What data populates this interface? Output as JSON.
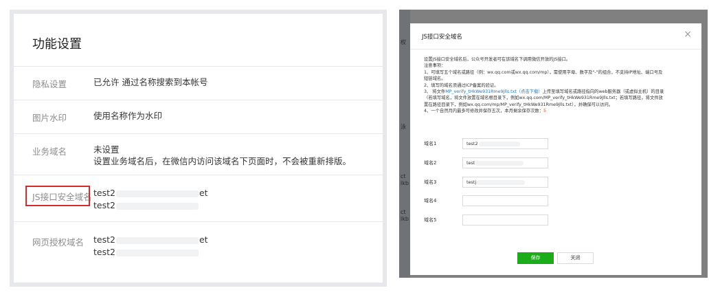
{
  "left": {
    "title": "功能设置",
    "rows": [
      {
        "label": "隐私设置",
        "lines": [
          "已允许 通过名称搜索到本帐号"
        ]
      },
      {
        "label": "图片水印",
        "lines": [
          "使用名称作为水印"
        ]
      },
      {
        "label": "业务域名",
        "lines": [
          "未设置",
          "设置业务域名后，在微信内访问该域名下页面时，不会被重新排版。"
        ]
      },
      {
        "label": "JS接口安全域名",
        "lines": [
          "test2",
          "test2"
        ],
        "tails": [
          "et",
          ""
        ]
      },
      {
        "label": "网页授权域名",
        "lines": [
          "test2",
          "test2"
        ],
        "tails": [
          "et",
          ""
        ]
      }
    ]
  },
  "dialog": {
    "title": "JS接口安全域名",
    "close_icon": "×",
    "desc": {
      "line1": "设置JS接口安全域名后，公众号开发者可在该域名下调用微信开放的JS接口。",
      "line2": "注意事项：",
      "line3": "1、可填写五个域名或路径（例：wx.qq.com或wx.qq.com/mp），需使用字母、数字及\"-\"的组合，不支持IP地址、端口号及",
      "line4": "短链域名。",
      "line5": "2、填写的域名须通过ICP备案的验证。",
      "line6a": "3、 将文件",
      "line6_link": "MP_verify_tHkWe931Rme9Jlls.txt",
      "line6_download": "（点击下载）",
      "line6b": "上传至填写域名或路径指向的web服务器（或虚拟主机）的目录",
      "line7": "（若填写域名，将文件放置在域名根目录下，例如wx.qq.com/MP_verify_tHkWe931Rme9Jlls.txt；若填写路径，将文件放",
      "line8": "置在路径目录下，例如wx.qq.com/mp/MP_verify_tHkWe931Rme9Jlls.txt），并确保可以访问。",
      "line9a": "4、一个自然月内最多可修改并保存五次，本月剩余保存次数：",
      "remaining": "5"
    },
    "fields": [
      {
        "label": "域名1",
        "value": "test2"
      },
      {
        "label": "域名2",
        "value": "test"
      },
      {
        "label": "域名3",
        "value": "testj"
      },
      {
        "label": "域名4",
        "value": ""
      },
      {
        "label": "域名5",
        "value": ""
      }
    ],
    "save_label": "保存",
    "close_label": "关闭"
  },
  "background_fragments": [
    "权",
    "泳",
    "ct",
    "lkb",
    "ct",
    "lkb"
  ],
  "colors": {
    "accent": "#1aad19",
    "highlight": "#d42a2a",
    "link": "#1f78c8"
  }
}
